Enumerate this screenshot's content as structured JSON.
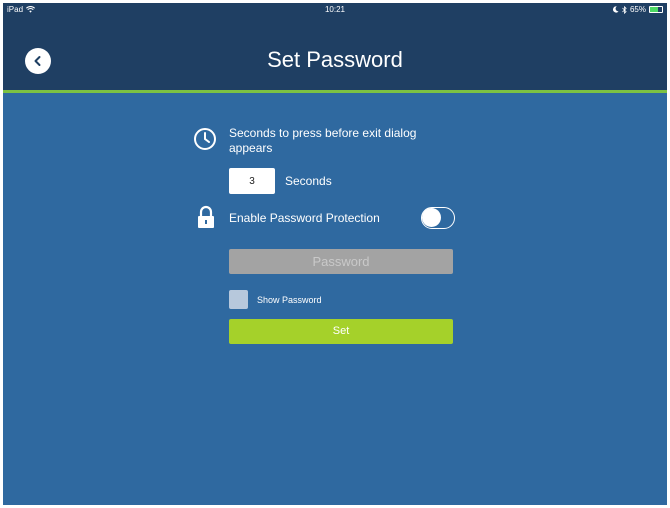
{
  "status_bar": {
    "device": "iPad",
    "time": "10:21",
    "battery": "65%",
    "battery_level": 0.65
  },
  "nav": {
    "title": "Set Password",
    "back_icon": "chevron-left-icon"
  },
  "exit_dialog": {
    "label": "Seconds to press before exit dialog appears",
    "icon": "clock-icon",
    "seconds_value": "3",
    "seconds_unit": "Seconds"
  },
  "password_protection": {
    "icon": "lock-icon",
    "label": "Enable Password Protection",
    "enabled": false,
    "password_placeholder": "Password",
    "show_password_label": "Show Password",
    "show_password_checked": false,
    "set_label": "Set"
  },
  "colors": {
    "background": "#2f69a0",
    "header": "#1f3f63",
    "accent_line": "#7cc242",
    "set_button": "#a5d12a"
  }
}
